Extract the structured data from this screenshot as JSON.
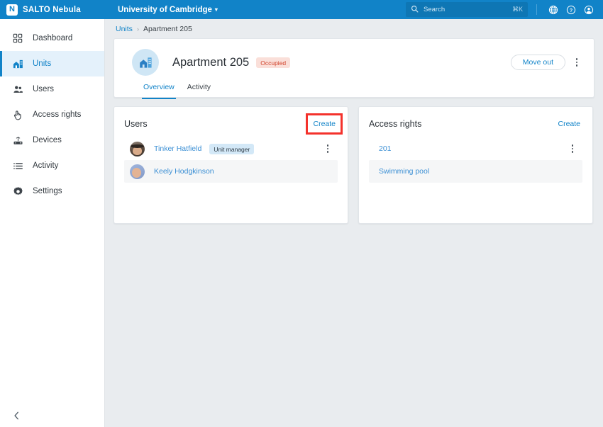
{
  "topbar": {
    "logo_letter": "N",
    "brand": "SALTO Nebula",
    "org": "University of Cambridge",
    "org_caret": "▾",
    "search_placeholder": "Search",
    "search_value": "",
    "search_shortcut": "⌘K",
    "icons": [
      "globe-icon",
      "help-icon",
      "account-icon"
    ],
    "accent": "#1183c8"
  },
  "sidebar": {
    "items": [
      {
        "label": "Dashboard",
        "icon": "dashboard-icon",
        "active": false
      },
      {
        "label": "Units",
        "icon": "units-icon",
        "active": true
      },
      {
        "label": "Users",
        "icon": "users-icon",
        "active": false
      },
      {
        "label": "Access rights",
        "icon": "access-rights-icon",
        "active": false
      },
      {
        "label": "Devices",
        "icon": "devices-icon",
        "active": false
      },
      {
        "label": "Activity",
        "icon": "activity-icon",
        "active": false
      },
      {
        "label": "Settings",
        "icon": "settings-icon",
        "active": false
      }
    ],
    "collapse_icon": "chevron-left-icon"
  },
  "breadcrumb": {
    "parent": "Units",
    "separator": "›",
    "current": "Apartment 205"
  },
  "unit": {
    "avatar_icon": "apartment-building-icon",
    "title": "Apartment 205",
    "status_badge": "Occupied",
    "status_badge_color": "#d2462f",
    "status_badge_bg": "#fadfd9",
    "move_out_label": "Move out",
    "overflow_icon": "kebab-menu-icon",
    "tabs": [
      {
        "label": "Overview",
        "active": true
      },
      {
        "label": "Activity",
        "active": false
      }
    ]
  },
  "users_panel": {
    "title": "Users",
    "create_label": "Create",
    "create_highlight_color": "#f4322c",
    "rows": [
      {
        "name": "Tinker Hatfield",
        "badge": "Unit manager",
        "has_menu": true,
        "alt": false
      },
      {
        "name": "Keely Hodgkinson",
        "badge": "",
        "has_menu": false,
        "alt": true
      }
    ]
  },
  "access_rights_panel": {
    "title": "Access rights",
    "create_label": "Create",
    "rows": [
      {
        "name": "201",
        "has_menu": true,
        "alt": false
      },
      {
        "name": "Swimming pool",
        "has_menu": false,
        "alt": true
      }
    ]
  }
}
